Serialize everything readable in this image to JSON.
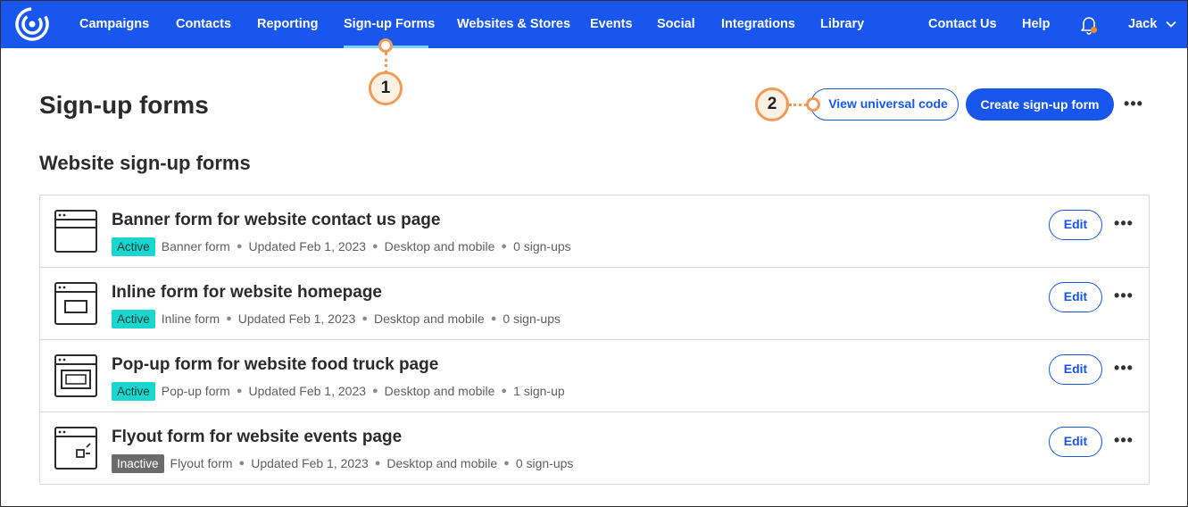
{
  "nav": {
    "items": [
      {
        "label": "Campaigns",
        "active": false
      },
      {
        "label": "Contacts",
        "active": false
      },
      {
        "label": "Reporting",
        "active": false
      },
      {
        "label": "Sign-up Forms",
        "active": true
      },
      {
        "label": "Websites & Stores",
        "active": false
      },
      {
        "label": "Events",
        "active": false
      },
      {
        "label": "Social",
        "active": false
      },
      {
        "label": "Integrations",
        "active": false
      },
      {
        "label": "Library",
        "active": false
      }
    ],
    "contact_us": "Contact Us",
    "help": "Help",
    "user": "Jack",
    "brand_color": "#1856ed",
    "notification_dot_color": "#f28c28"
  },
  "callouts": [
    {
      "number": "1"
    },
    {
      "number": "2"
    }
  ],
  "header": {
    "title": "Sign-up forms",
    "view_universal_code": "View universal code",
    "create_form": "Create sign-up form",
    "more": "•••"
  },
  "section": {
    "title": "Website sign-up forms"
  },
  "forms": [
    {
      "title": "Banner form for website contact us page",
      "status": "Active",
      "type": "Banner form",
      "updated": "Updated Feb 1, 2023",
      "devices": "Desktop and mobile",
      "signups": "0 sign-ups",
      "icon": "banner-form-icon",
      "edit": "Edit",
      "more": "•••"
    },
    {
      "title": "Inline form for website homepage",
      "status": "Active",
      "type": "Inline form",
      "updated": "Updated Feb 1, 2023",
      "devices": "Desktop and mobile",
      "signups": "0 sign-ups",
      "icon": "inline-form-icon",
      "edit": "Edit",
      "more": "•••"
    },
    {
      "title": "Pop-up form for website food truck page",
      "status": "Active",
      "type": "Pop-up form",
      "updated": "Updated Feb 1, 2023",
      "devices": "Desktop and mobile",
      "signups": "1 sign-up",
      "icon": "popup-form-icon",
      "edit": "Edit",
      "more": "•••"
    },
    {
      "title": "Flyout form for website events page",
      "status": "Inactive",
      "type": "Flyout form",
      "updated": "Updated Feb 1, 2023",
      "devices": "Desktop and mobile",
      "signups": "0 sign-ups",
      "icon": "flyout-form-icon",
      "edit": "Edit",
      "more": "•••"
    }
  ],
  "colors": {
    "active_badge": "#19d6cf",
    "inactive_badge": "#6b6b6b",
    "callout": "#f29a58"
  }
}
